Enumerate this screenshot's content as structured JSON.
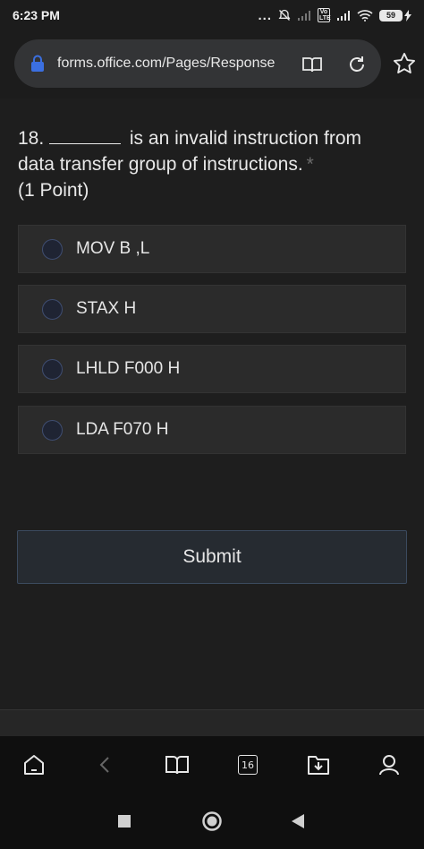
{
  "status_bar": {
    "time": "6:23 PM",
    "dots": "...",
    "volte_label": "Vo LTE",
    "battery_percent": "59"
  },
  "browser": {
    "url": "forms.office.com/Pages/Response",
    "icons": [
      "lock-icon",
      "reader-mode-icon",
      "reload-icon",
      "star-icon"
    ]
  },
  "question": {
    "number": "18.",
    "text": "is an invalid instruction from data transfer group of instructions.",
    "required_marker": "*",
    "points": "(1 Point)"
  },
  "options": [
    {
      "label": "MOV B ,L",
      "selected": false
    },
    {
      "label": "STAX H",
      "selected": false
    },
    {
      "label": "LHLD F000 H",
      "selected": false
    },
    {
      "label": "LDA F070 H",
      "selected": false
    }
  ],
  "submit": {
    "label": "Submit"
  },
  "toolbar": {
    "tab_count": "16",
    "icons": [
      "home-icon",
      "back-icon",
      "bookmarks-icon",
      "tabs-icon",
      "downloads-icon",
      "profile-icon"
    ]
  },
  "system_nav": {
    "icons": [
      "recents-square-icon",
      "home-circle-icon",
      "back-triangle-icon"
    ]
  },
  "colors": {
    "background": "#1e1e1e",
    "option_bg": "#2b2b2b",
    "radio_border": "#3f4d70",
    "submit_border": "#3b4a5e",
    "lock_accent": "#3b6fe0"
  }
}
